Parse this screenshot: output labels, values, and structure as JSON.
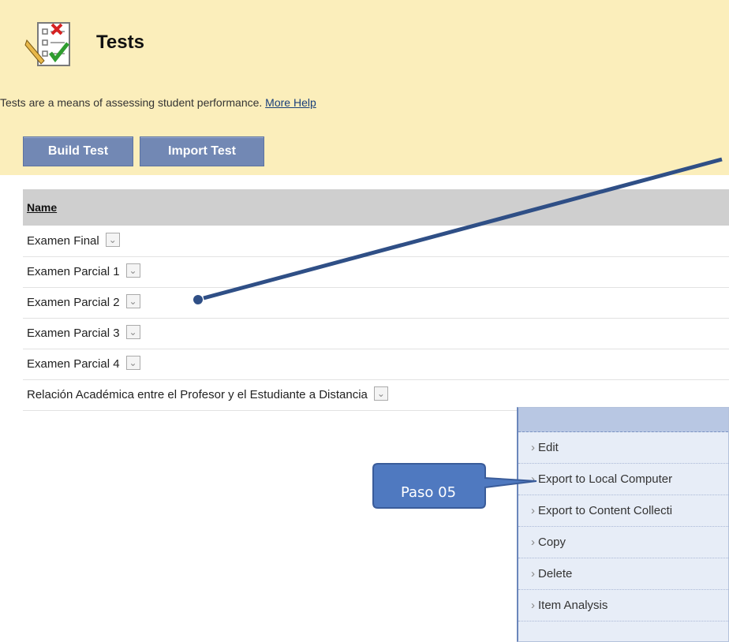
{
  "header": {
    "title": "Tests",
    "description": "Tests are a means of assessing student performance.",
    "more_help": "More Help",
    "buttons": {
      "build": "Build Test",
      "import": "Import Test"
    },
    "icon": "test-checklist-icon"
  },
  "table": {
    "column_name": "Name",
    "rows": [
      "Examen Final",
      "Examen Parcial 1",
      "Examen Parcial 2",
      "Examen Parcial 3",
      "Examen Parcial 4",
      "Relación Académica entre el Profesor y el Estudiante a Distancia"
    ]
  },
  "context_menu": {
    "items": [
      "Edit",
      "Export to Local Computer",
      "Export to Content Collecti",
      "Copy",
      "Delete",
      "Item Analysis"
    ]
  },
  "annotation": {
    "callout_text": "Paso 05"
  },
  "colors": {
    "header_bg": "#fbeebb",
    "button_bg": "#7288b4",
    "menu_bg": "#e7edf7",
    "arrow": "#2f4f86"
  }
}
